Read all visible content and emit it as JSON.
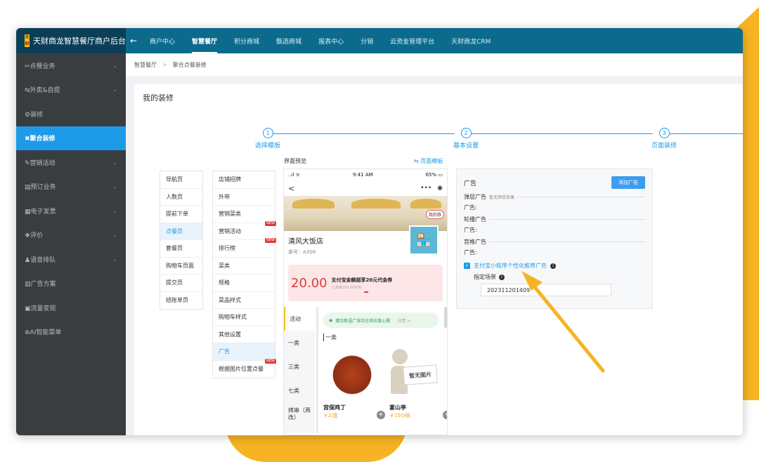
{
  "brand": {
    "logo_text": "天财商龙",
    "title": "天财商龙智慧餐厅商户后台"
  },
  "topnav": {
    "back_icon": "arrow-left-icon",
    "items": [
      {
        "label": "商户中心"
      },
      {
        "label": "智慧餐厅"
      },
      {
        "label": "积分商城"
      },
      {
        "label": "甄选商城"
      },
      {
        "label": "报表中心"
      },
      {
        "label": "分销"
      },
      {
        "label": "云资金管理平台"
      },
      {
        "label": "天财商龙CRM"
      }
    ],
    "active": "智慧餐厅"
  },
  "sidebar": {
    "items": [
      {
        "label": "✂点餐业务",
        "caret": "⌄"
      },
      {
        "label": "⇆外卖&自提",
        "caret": "⌄"
      },
      {
        "label": "⚙装修",
        "caret": ""
      },
      {
        "label": "✖聚合装修",
        "caret": ""
      },
      {
        "label": "✎营销活动",
        "caret": "⌄"
      },
      {
        "label": "▤预订业务",
        "caret": "⌄"
      },
      {
        "label": "▦电子发票",
        "caret": "⌄"
      },
      {
        "label": "❖评价",
        "caret": "⌄"
      },
      {
        "label": "♟语音排队",
        "caret": "⌄"
      },
      {
        "label": "▥广告方案",
        "caret": ""
      },
      {
        "label": "▣流量变现",
        "caret": ""
      },
      {
        "label": "⊛AI智能菜单",
        "caret": ""
      }
    ],
    "active_index": 3
  },
  "breadcrumb": {
    "parent": "智慧餐厅",
    "separator": ">",
    "current": "聚合点餐装修"
  },
  "page_title": "我的装修",
  "steps": [
    {
      "num": "1",
      "label": "选择模板"
    },
    {
      "num": "2",
      "label": "基本设置"
    },
    {
      "num": "3",
      "label": "页面装修"
    }
  ],
  "page_menu": [
    {
      "label": "导航页"
    },
    {
      "label": "人数页"
    },
    {
      "label": "提前下单"
    },
    {
      "label": "点餐页"
    },
    {
      "label": "套餐页"
    },
    {
      "label": "购物车页面"
    },
    {
      "label": "提交页"
    },
    {
      "label": "结账单页"
    }
  ],
  "page_menu_selected": 3,
  "component_menu": [
    {
      "label": "店铺招牌",
      "new": ""
    },
    {
      "label": "外带",
      "new": ""
    },
    {
      "label": "营销菜类",
      "new": ""
    },
    {
      "label": "营销活动",
      "new": "NEW"
    },
    {
      "label": "排行榜",
      "new": "NEW"
    },
    {
      "label": "菜类",
      "new": ""
    },
    {
      "label": "规格",
      "new": ""
    },
    {
      "label": "菜品样式",
      "new": ""
    },
    {
      "label": "购物车样式",
      "new": ""
    },
    {
      "label": "其他设置",
      "new": ""
    },
    {
      "label": "广告",
      "new": ""
    },
    {
      "label": "根据图片位置点餐",
      "new": "NEW"
    }
  ],
  "component_menu_selected": 10,
  "preview": {
    "label": "界面预览",
    "template_link": "⇆ 页面模板",
    "status_left": "..ıl ᯤ",
    "status_time": "9:41 AM",
    "status_battery": "65% ▭",
    "back": "<",
    "capsule_dots": "•••",
    "capsule_target": "◉",
    "my_coupon": "我的券",
    "shop_name": "清风大饭店",
    "table_no": "桌号：A306",
    "coupon_amount": "20.00",
    "coupon_title": "支付宝金额超享20元代金券",
    "coupon_sub": "立减满200.00可用",
    "categories": [
      {
        "label": "活动"
      },
      {
        "label": "一类"
      },
      {
        "label": "三类"
      },
      {
        "label": "七类"
      },
      {
        "label": "烤串（再改）"
      }
    ],
    "notice": "蛋包新语广深正在供应爱心餐",
    "notice_more": "详情 >",
    "category_head": "一类",
    "foods": [
      {
        "name": "宫保鸡丁",
        "price": "￥2/盒"
      },
      {
        "name": "宴山亭",
        "price": "￥150/碗",
        "placeholder": "暂无图片"
      }
    ]
  },
  "ad_panel": {
    "title": "广告",
    "add_button": "添加广告",
    "popup_label": "弹层广告",
    "popup_hint": "暂无预览效果",
    "popup_sub": "广告:",
    "carousel_label": "轮播广告",
    "carousel_sub": "广告:",
    "grid_label": "宫格广告",
    "grid_sub": "广告:",
    "checkbox_label": "支付宝小程序个性化推荐广告",
    "checkbox_checked": "✓",
    "scene_label": "指定场景",
    "scene_value": "202311201409"
  },
  "colors": {
    "topbar": "#0c6b8c",
    "sidebar": "#3a3d40",
    "accent": "#1d9be8",
    "annotation": "#f6b323"
  }
}
